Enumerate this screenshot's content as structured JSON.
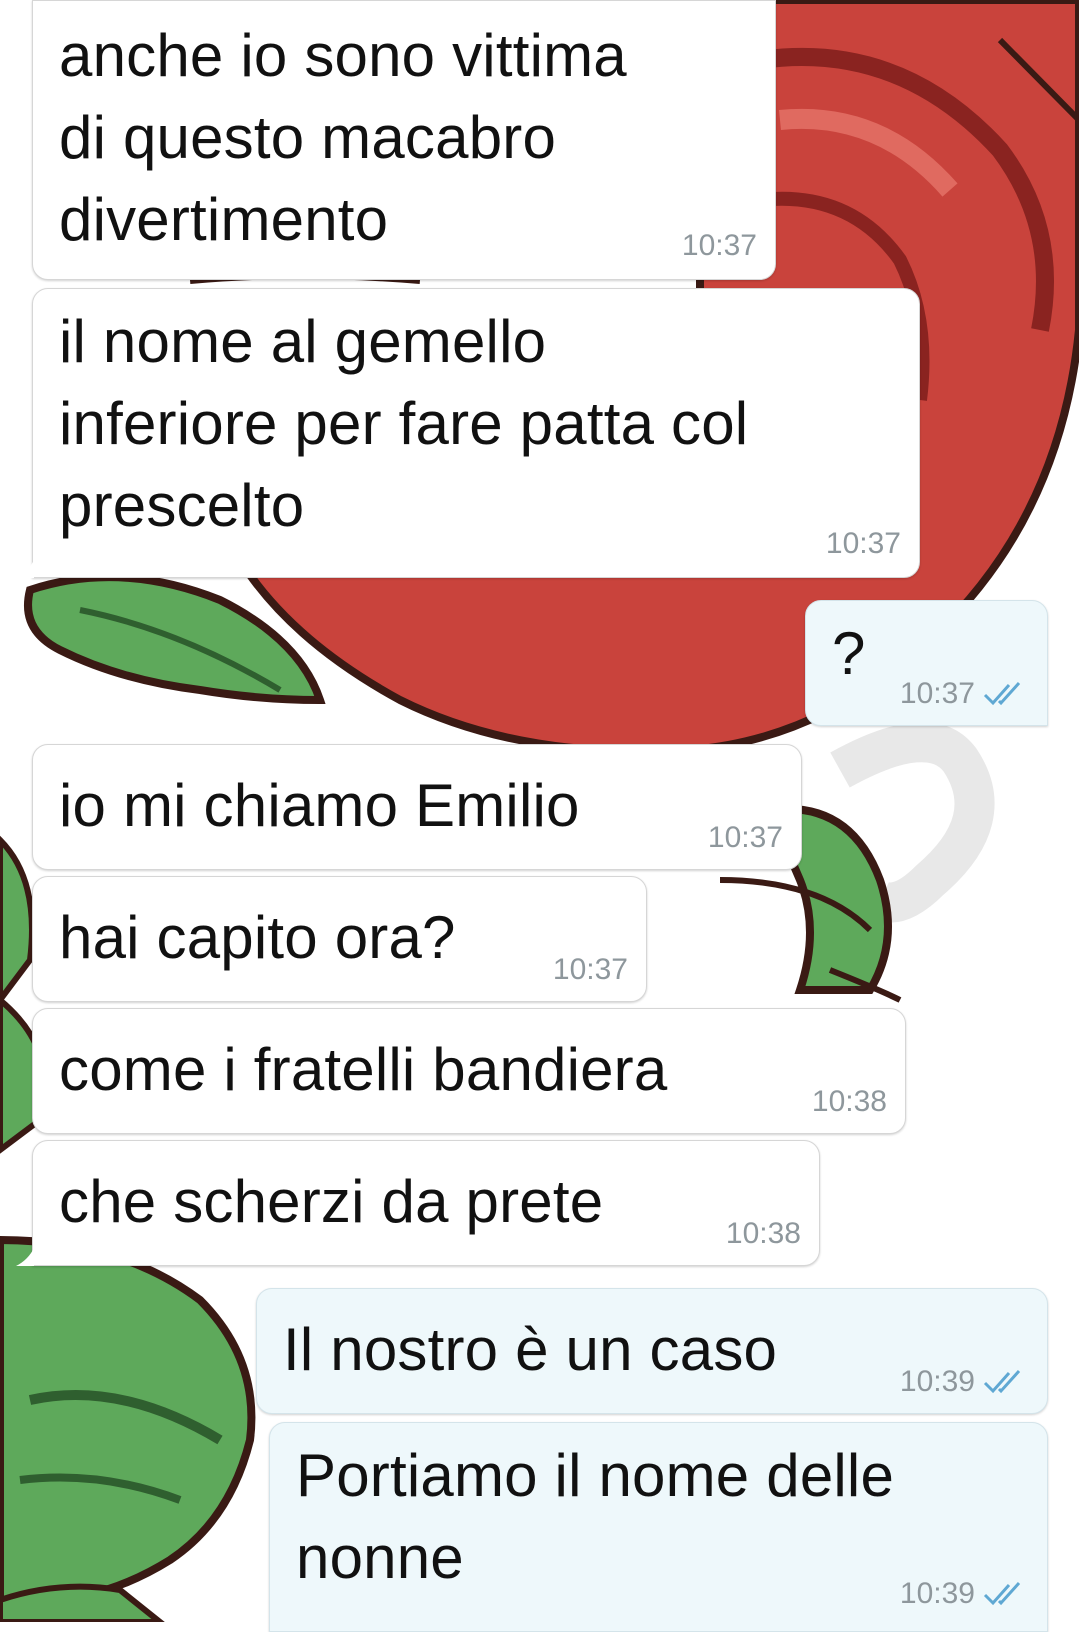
{
  "chat": {
    "messages": [
      {
        "id": "m1",
        "direction": "in",
        "text": "anche io sono vittima\ndi questo macabro\ndivertimento",
        "time": "10:37"
      },
      {
        "id": "m2",
        "direction": "in",
        "text": "il nome al gemello\ninferiore per fare patta col\nprescelto",
        "time": "10:37"
      },
      {
        "id": "m3",
        "direction": "out",
        "text": "?",
        "time": "10:37",
        "status_icon": "double-check-icon"
      },
      {
        "id": "m4",
        "direction": "in",
        "text": "io mi chiamo Emilio",
        "time": "10:37"
      },
      {
        "id": "m5",
        "direction": "in",
        "text": "hai capito ora?",
        "time": "10:37"
      },
      {
        "id": "m6",
        "direction": "in",
        "text": "come i fratelli bandiera",
        "time": "10:38"
      },
      {
        "id": "m7",
        "direction": "in",
        "text": "che scherzi da prete",
        "time": "10:38"
      },
      {
        "id": "m8",
        "direction": "out",
        "text": "Il nostro è un caso",
        "time": "10:39",
        "status_icon": "double-check-icon"
      },
      {
        "id": "m9",
        "direction": "out",
        "text": "Portiamo il nome delle\nnonne",
        "time": "10:39",
        "status_icon": "double-check-icon"
      }
    ]
  },
  "theme": {
    "incoming_bubble": "#ffffff",
    "outgoing_bubble": "#eef8fb",
    "timestamp_color": "#8e979c",
    "check_color": "#5fa8d3",
    "wallpaper_red": "#c8433c",
    "wallpaper_green": "#5aa65a"
  }
}
